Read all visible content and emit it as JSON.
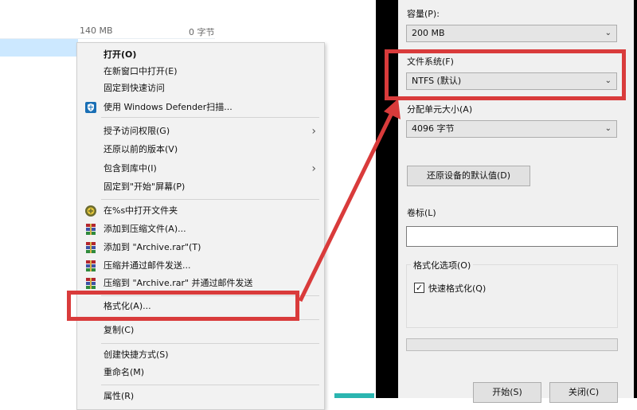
{
  "explorer": {
    "total_size": "140 MB",
    "free_size": "0 字节"
  },
  "context_menu": {
    "items": [
      {
        "label": "打开(O)",
        "bold": true
      },
      {
        "label": "在新窗口中打开(E)"
      },
      {
        "label": "固定到快速访问"
      },
      {
        "label": "使用 Windows Defender扫描...",
        "icon": "windows-defender-shield-icon"
      },
      {
        "label": "授予访问权限(G)",
        "submenu": true
      },
      {
        "label": "还原以前的版本(V)"
      },
      {
        "label": "包含到库中(I)",
        "submenu": true
      },
      {
        "label": "固定到\"开始\"屏幕(P)"
      },
      {
        "label": "在%s中打开文件夹",
        "icon": "folder-app-icon"
      },
      {
        "label": "添加到压缩文件(A)...",
        "icon": "winrar-archive-icon"
      },
      {
        "label": "添加到 \"Archive.rar\"(T)",
        "icon": "winrar-archive-icon"
      },
      {
        "label": "压缩并通过邮件发送...",
        "icon": "winrar-archive-icon"
      },
      {
        "label": "压缩到 \"Archive.rar\" 并通过邮件发送",
        "icon": "winrar-archive-icon"
      },
      {
        "label": "格式化(A)..."
      },
      {
        "label": "复制(C)"
      },
      {
        "label": "创建快捷方式(S)"
      },
      {
        "label": "重命名(M)"
      },
      {
        "label": "属性(R)"
      }
    ],
    "submenu_arrow": "›"
  },
  "format_dialog": {
    "capacity_label": "容量(P):",
    "capacity_value": "200 MB",
    "filesystem_label": "文件系统(F)",
    "filesystem_value": "NTFS (默认)",
    "allocation_label": "分配单元大小(A)",
    "allocation_value": "4096 字节",
    "restore_defaults_button": "还原设备的默认值(D)",
    "volume_label_label": "卷标(L)",
    "volume_label_value": "",
    "format_options_label": "格式化选项(O)",
    "quick_format_label": "快速格式化(Q)",
    "quick_format_checked": true,
    "start_button": "开始(S)",
    "close_button": "关闭(C)",
    "caret": "⌄"
  },
  "colors": {
    "annotation_red": "#d93b3b",
    "selection_blue": "#cce8ff",
    "menu_background": "#f2f2f2",
    "dialog_background": "#f0f0f0"
  }
}
